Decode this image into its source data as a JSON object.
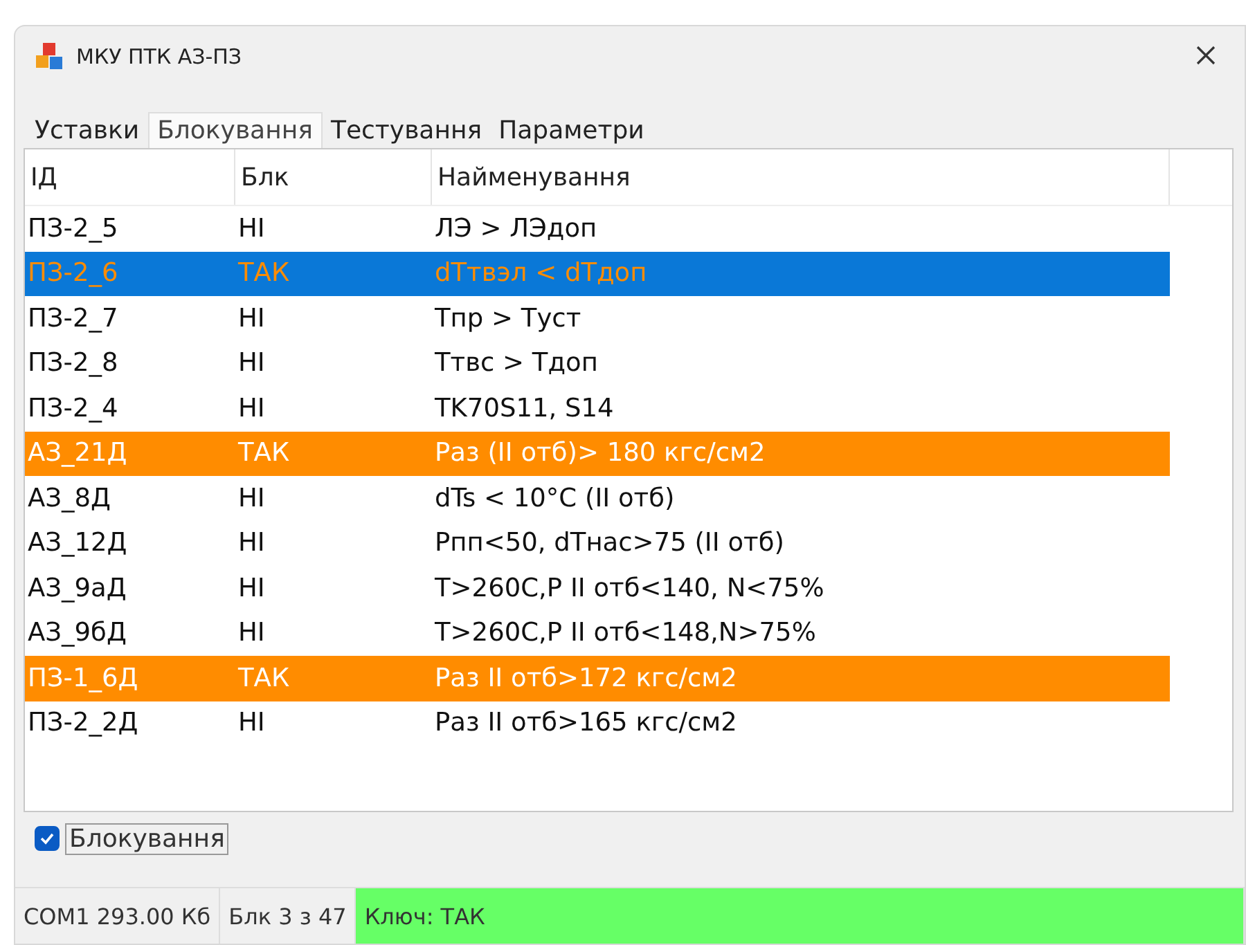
{
  "window": {
    "title": "МКУ ПТК АЗ-ПЗ"
  },
  "tabs": [
    {
      "label": "Уставки",
      "selected": false
    },
    {
      "label": "Блокування",
      "selected": true
    },
    {
      "label": "Тестування",
      "selected": false
    },
    {
      "label": "Параметри",
      "selected": false
    }
  ],
  "table": {
    "columns": [
      "ІД",
      "Блк",
      "Найменування"
    ],
    "rows": [
      {
        "cells": [
          "ПЗ-2_5",
          "НІ",
          "ЛЭ > ЛЭдоп"
        ],
        "selected": false,
        "blocked": false
      },
      {
        "cells": [
          "ПЗ-2_6",
          "ТАК",
          "dTтвэл < dTдоп"
        ],
        "selected": true,
        "blocked": true
      },
      {
        "cells": [
          "ПЗ-2_7",
          "НІ",
          "Tпр > Tуст"
        ],
        "selected": false,
        "blocked": false
      },
      {
        "cells": [
          "ПЗ-2_8",
          "НІ",
          "Tтвс > Tдоп"
        ],
        "selected": false,
        "blocked": false
      },
      {
        "cells": [
          "ПЗ-2_4",
          "НІ",
          "TK70S11, S14"
        ],
        "selected": false,
        "blocked": false
      },
      {
        "cells": [
          "АЗ_21Д",
          "ТАК",
          "Раз (ІІ отб)> 180 кгс/см2"
        ],
        "selected": false,
        "blocked": true
      },
      {
        "cells": [
          "АЗ_8Д",
          "НІ",
          "dTs < 10°C (ІІ отб)"
        ],
        "selected": false,
        "blocked": false
      },
      {
        "cells": [
          "АЗ_12Д",
          "НІ",
          "Рпп<50, dTнас>75 (ІІ отб)"
        ],
        "selected": false,
        "blocked": false
      },
      {
        "cells": [
          "АЗ_9аД",
          "НІ",
          "T>260C,P ІІ отб<140, N<75%"
        ],
        "selected": false,
        "blocked": false
      },
      {
        "cells": [
          "АЗ_9бД",
          "НІ",
          "T>260C,P ІІ отб<148,N>75%"
        ],
        "selected": false,
        "blocked": false
      },
      {
        "cells": [
          "ПЗ-1_6Д",
          "ТАК",
          "Раз ІІ отб>172 кгс/см2"
        ],
        "selected": false,
        "blocked": true
      },
      {
        "cells": [
          "ПЗ-2_2Д",
          "НІ",
          "Раз ІІ отб>165 кгс/см2"
        ],
        "selected": false,
        "blocked": false
      }
    ]
  },
  "checkbox": {
    "label": "Блокування",
    "checked": true
  },
  "status_bar": [
    {
      "text": "COM1 293.00 Кб",
      "kind": "plain"
    },
    {
      "text": "Блк 3 з 47",
      "kind": "plain"
    },
    {
      "text": "Ключ: ТАК",
      "kind": "ok"
    }
  ]
}
